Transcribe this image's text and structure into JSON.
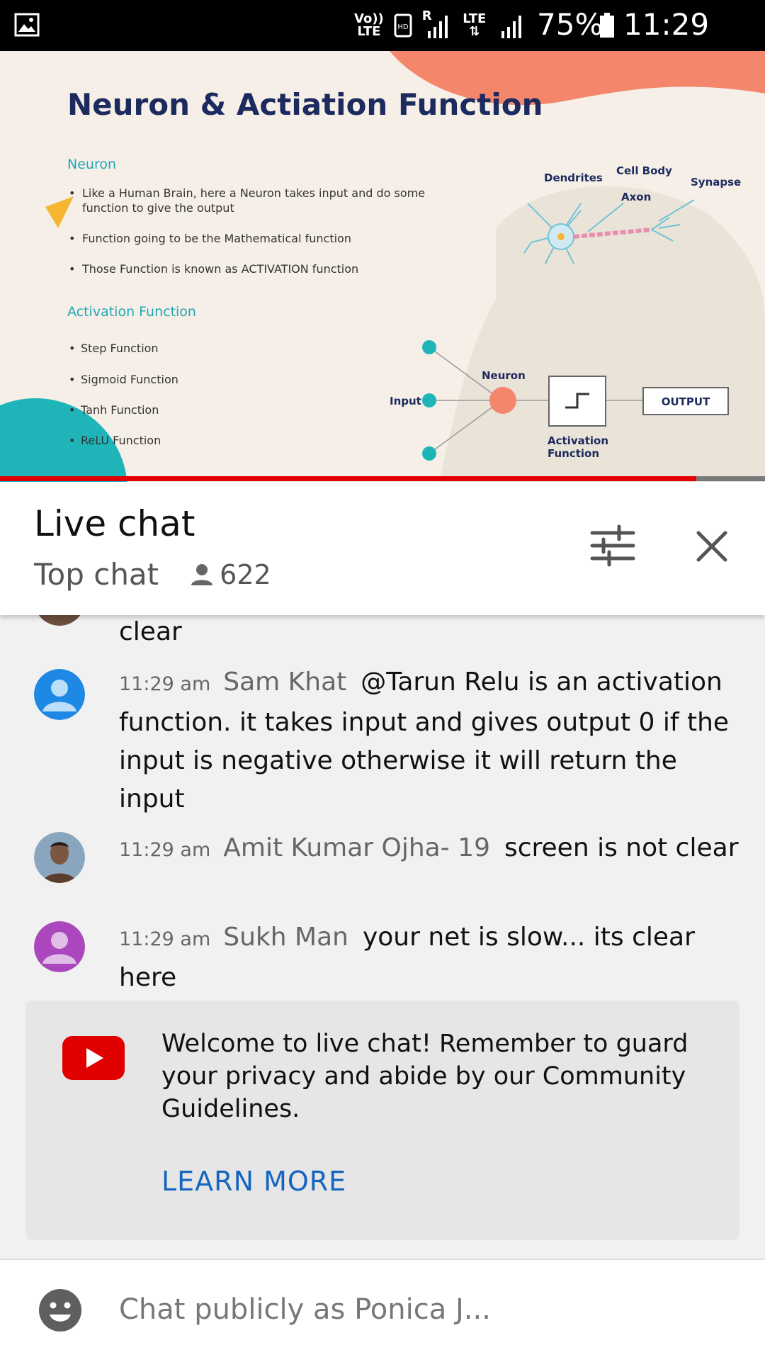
{
  "status_bar": {
    "volte_label": "Vo))",
    "lte_label": "LTE",
    "hd_label": "HD",
    "roaming_label": "R",
    "lte2_label": "LTE",
    "battery_percent": "75%",
    "time": "11:29 am",
    "icons": [
      "image-icon",
      "hd-icon",
      "signal-icon",
      "signal-icon",
      "battery-icon"
    ]
  },
  "video": {
    "progress_fraction": 0.91,
    "slide": {
      "title": "Neuron & Actiation Function",
      "section1_heading": "Neuron",
      "section1_bullets": [
        "Like a Human Brain, here a Neuron takes input and do some",
        "function to give the output",
        "Function going to be the Mathematical function",
        "Those Function is known as ACTIVATION function"
      ],
      "section2_heading": "Activation Function",
      "section2_bullets": [
        "Step Function",
        "Sigmoid Function",
        "Tanh Function",
        "ReLU Function"
      ],
      "neuron_labels": {
        "dendrites": "Dendrites",
        "cell_body": "Cell Body",
        "axon": "Axon",
        "synapse": "Synapse"
      },
      "diagram_labels": {
        "input": "Input",
        "neuron": "Neuron",
        "activation_line1": "Activation",
        "activation_line2": "Function",
        "output": "OUTPUT"
      },
      "colors": {
        "title": "#1c2a5e",
        "heading": "#22a7b8",
        "teal": "#1fb5b8",
        "coral": "#f4866b"
      }
    }
  },
  "chat_header": {
    "title": "Live chat",
    "mode": "Top chat",
    "viewer_count": "622",
    "icons": [
      "person-icon",
      "filter-icon",
      "close-icon"
    ]
  },
  "messages": [
    {
      "text": "clear"
    },
    {
      "time": "11:29 am",
      "author": "Sam Khat",
      "text": "@Tarun Relu is an activation function. it takes input and gives output 0 if the input is negative otherwise it will return the input",
      "avatar_color": "#1e88e5"
    },
    {
      "time": "11:29 am",
      "author": "Amit Kumar Ojha- 19",
      "text": "screen is not clear",
      "avatar_color": "#8aa6bf"
    },
    {
      "time": "11:29 am",
      "author": "Sukh Man",
      "text": "your net is slow... its clear here",
      "avatar_color": "#ab47bc"
    }
  ],
  "welcome": {
    "text": "Welcome to live chat! Remember to guard your privacy and abide by our Community Guidelines.",
    "learn_more": "LEARN MORE",
    "brand_color": "#e00000"
  },
  "input": {
    "placeholder": "Chat publicly as Ponica J..."
  }
}
